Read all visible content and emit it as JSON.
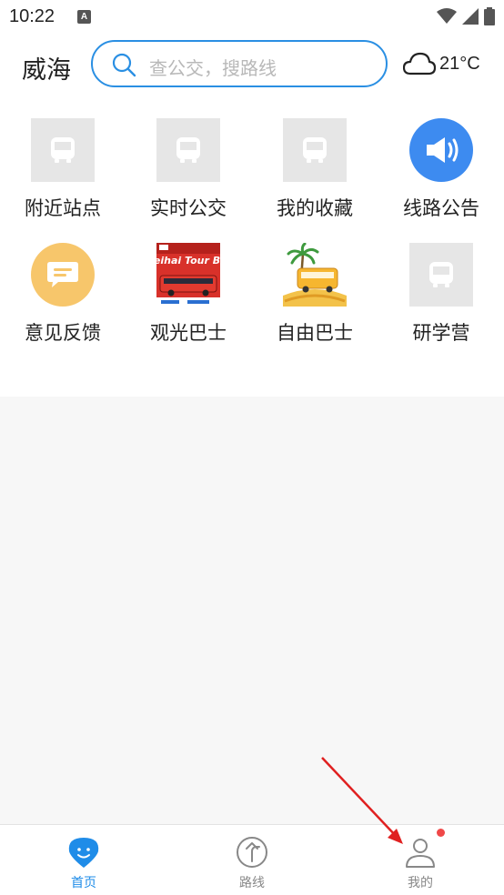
{
  "status_bar": {
    "time": "10:22",
    "notification_glyph": "A",
    "icons": [
      "wifi-icon",
      "signal-icon",
      "battery-icon"
    ]
  },
  "header": {
    "city": "威海",
    "search_placeholder": "查公交，搜路线",
    "weather_icon": "cloud-icon",
    "temperature": "21°C"
  },
  "quick_actions": [
    {
      "label": "附近站点",
      "icon": "bus-placeholder-icon"
    },
    {
      "label": "实时公交",
      "icon": "bus-placeholder-icon"
    },
    {
      "label": "我的收藏",
      "icon": "bus-placeholder-icon"
    },
    {
      "label": "线路公告",
      "icon": "megaphone-icon"
    },
    {
      "label": "意见反馈",
      "icon": "feedback-message-icon"
    },
    {
      "label": "观光巴士",
      "icon": "weihai-tour-bus-poster",
      "poster_text": "Weihai Tour Bus"
    },
    {
      "label": "自由巴士",
      "icon": "palm-bus-illustration"
    },
    {
      "label": "研学营",
      "icon": "bus-placeholder-icon"
    }
  ],
  "bottom_nav": [
    {
      "label": "首页",
      "icon": "home-pin-icon",
      "active": true
    },
    {
      "label": "路线",
      "icon": "route-arrow-icon",
      "active": false
    },
    {
      "label": "我的",
      "icon": "profile-icon",
      "active": false,
      "badge": true
    }
  ],
  "colors": {
    "accent": "#1f8ce8",
    "megaphone_bg": "#3d8bf0",
    "feedback_bg": "#f7c66b",
    "badge": "#f04848",
    "annotation_arrow": "#e02020"
  }
}
